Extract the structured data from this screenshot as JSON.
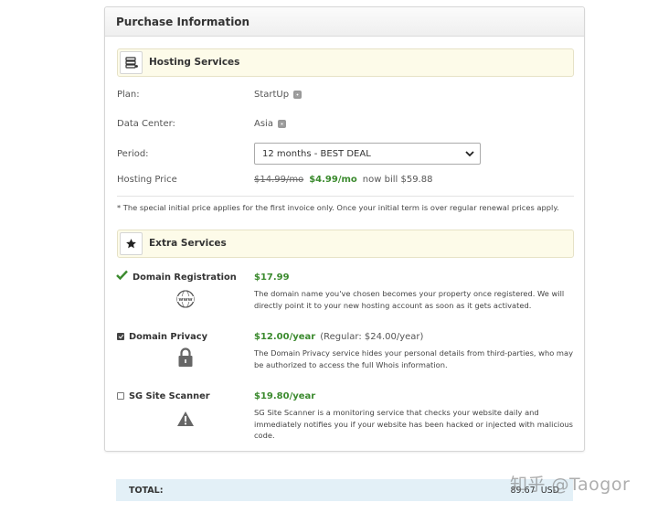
{
  "purchase": {
    "title": "Purchase Information"
  },
  "hosting": {
    "section_title": "Hosting Services",
    "plan_label": "Plan:",
    "plan_value": "StartUp",
    "datacenter_label": "Data Center:",
    "datacenter_value": "Asia",
    "period_label": "Period:",
    "period_selected": "12 months - BEST DEAL",
    "price_label": "Hosting Price",
    "price_old": "$14.99/mo",
    "price_new": "$4.99/mo",
    "price_bill": "now bill $59.88"
  },
  "note": "* The special initial price applies for the first invoice only. Once your initial term is over regular renewal prices apply.",
  "extras": {
    "section_title": "Extra Services",
    "items": [
      {
        "name": "Domain Registration",
        "price": "$17.99",
        "regular": "",
        "description": "The domain name you've chosen becomes your property once registered. We will directly point it to your new hosting account as soon as it gets activated.",
        "icon": "www-icon",
        "icon_text": "www",
        "state": "included"
      },
      {
        "name": "Domain Privacy",
        "price": "$12.00/year",
        "regular": "(Regular: $24.00/year)",
        "description": "The Domain Privacy service hides your personal details from third-parties, who may be authorized to access the full Whois information.",
        "icon": "lock-icon",
        "state": "checked"
      },
      {
        "name": "SG Site Scanner",
        "price": "$19.80/year",
        "regular": "",
        "description": "SG Site Scanner is a monitoring service that checks your website daily and immediately notifies you if your website has been hacked or injected with malicious code.",
        "icon": "warning-icon",
        "state": "unchecked"
      }
    ]
  },
  "total": {
    "label": "TOTAL:",
    "amount": "89.67",
    "currency": "USD"
  },
  "watermark": "知乎 @Taogor",
  "colors": {
    "accent_green": "#3b8a2e",
    "section_bg": "#fdfbe9",
    "total_bg": "#e3f0f7"
  }
}
